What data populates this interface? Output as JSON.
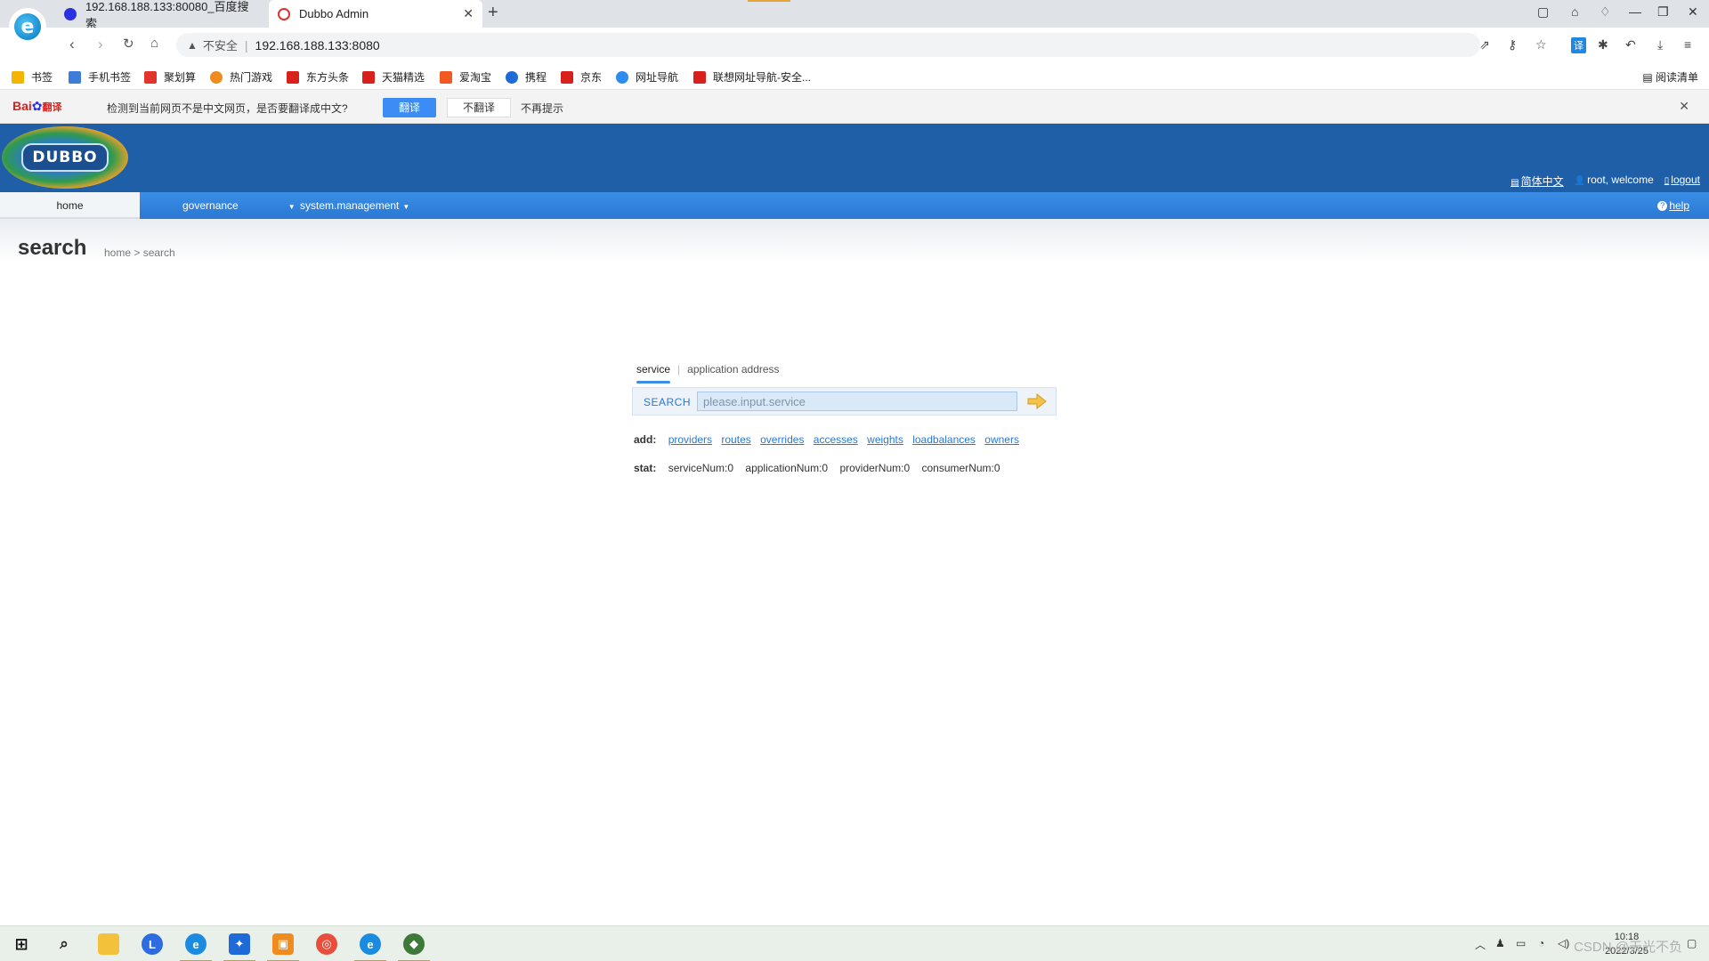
{
  "browser": {
    "tabs": [
      {
        "title": "192.168.188.133:80080_百度搜索"
      },
      {
        "title": "Dubbo Admin"
      }
    ],
    "security_label": "不安全",
    "url": "192.168.188.133:8080",
    "bookmarks": [
      {
        "label": "书签",
        "color": "#f5b400"
      },
      {
        "label": "手机书签",
        "color": "#3b7dd8"
      },
      {
        "label": "聚划算",
        "color": "#e3352b"
      },
      {
        "label": "热门游戏",
        "color": "#f08b1f"
      },
      {
        "label": "东方头条",
        "color": "#d8211d"
      },
      {
        "label": "天猫精选",
        "color": "#d8211d"
      },
      {
        "label": "爱淘宝",
        "color": "#f05a22"
      },
      {
        "label": "携程",
        "color": "#1d6ad8"
      },
      {
        "label": "京东",
        "color": "#d8211d"
      },
      {
        "label": "网址导航",
        "color": "#2d8cf0"
      },
      {
        "label": "联想网址导航-安全...",
        "color": "#d8211d"
      }
    ],
    "reading_list": "阅读清单"
  },
  "translate_bar": {
    "logo_text": "Bai",
    "logo_suffix": "翻译",
    "message": "检测到当前网页不是中文网页，是否要翻译成中文?",
    "translate_btn": "翻译",
    "no_translate_btn": "不翻译",
    "never_show": "不再提示"
  },
  "dubbo": {
    "logo_text": "DUBBO",
    "header_links": {
      "language": "简体中文",
      "welcome": "root, welcome",
      "logout": "logout"
    },
    "nav": {
      "home": "home",
      "governance": "governance",
      "system_management": "system.management",
      "help": "help"
    },
    "page_title": "search",
    "breadcrumb": "home > search",
    "search": {
      "tab_active": "service",
      "tab_inactive": "application address",
      "label": "SEARCH",
      "placeholder": "please.input.service"
    },
    "add": {
      "label": "add:",
      "links": [
        "providers",
        "routes",
        "overrides",
        "accesses",
        "weights",
        "loadbalances",
        "owners"
      ]
    },
    "stat": {
      "label": "stat:",
      "service_num": "serviceNum:0",
      "application_num": "applicationNum:0",
      "provider_num": "providerNum:0",
      "consumer_num": "consumerNum:0"
    }
  },
  "taskbar": {
    "time": "10:18",
    "date": "2022/3/25",
    "watermark": "CSDN @天光不负"
  }
}
